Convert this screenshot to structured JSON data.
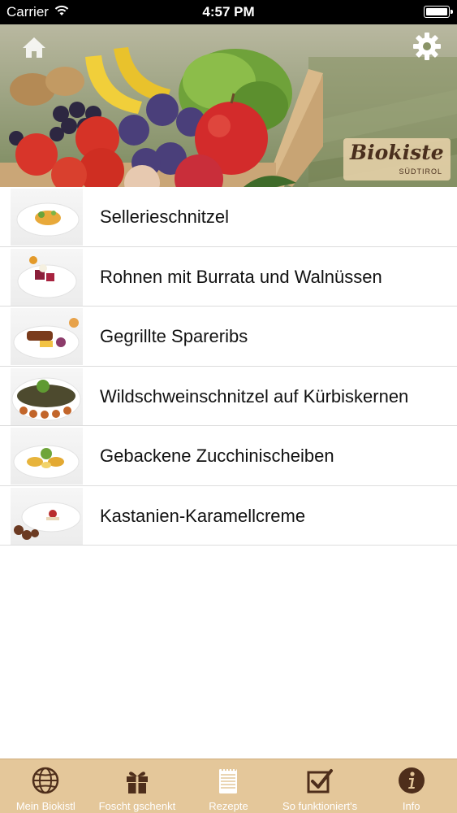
{
  "status_bar": {
    "carrier": "Carrier",
    "time": "4:57 PM"
  },
  "header": {
    "logo_text": "Biokiste",
    "logo_subtext": "SÜDTIROL"
  },
  "recipes": [
    {
      "title": "Sellerieschnitzel",
      "icon": "plated-dish-photo"
    },
    {
      "title": "Rohnen mit Burrata und Walnüssen",
      "icon": "plated-dish-photo"
    },
    {
      "title": "Gegrillte Spareribs",
      "icon": "plated-dish-photo"
    },
    {
      "title": "Wildschweinschnitzel auf Kürbiskernen",
      "icon": "plated-dish-photo"
    },
    {
      "title": "Gebackene Zucchinischeiben",
      "icon": "plated-dish-photo"
    },
    {
      "title": "Kastanien-Karamellcreme",
      "icon": "plated-dish-photo"
    }
  ],
  "tabs": [
    {
      "label": "Mein Biokistl",
      "icon": "globe-icon",
      "active": false
    },
    {
      "label": "Foscht gschenkt",
      "icon": "gift-icon",
      "active": false
    },
    {
      "label": "Rezepte",
      "icon": "notepad-icon",
      "active": true
    },
    {
      "label": "So funktioniert's",
      "icon": "checkbox-icon",
      "active": false
    },
    {
      "label": "Info",
      "icon": "info-icon",
      "active": false
    }
  ],
  "colors": {
    "tab_bar_background": "#e4c79a",
    "tab_icon": "#4e2e1b",
    "tab_icon_active": "#ffffff",
    "status_bar": "#000000"
  }
}
